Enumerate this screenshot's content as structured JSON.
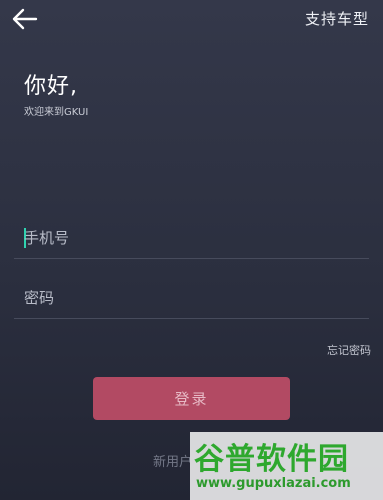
{
  "header": {
    "back_icon": "arrow-left-icon",
    "support_label": "支持车型"
  },
  "welcome": {
    "greeting": "你好,",
    "subtitle": "欢迎来到GKUI"
  },
  "form": {
    "phone_placeholder": "手机号",
    "phone_value": "",
    "password_placeholder": "密码",
    "password_value": "",
    "forgot_label": "忘记密码",
    "login_label": "登录",
    "new_user_label": "新用户"
  },
  "watermark": {
    "logo_text": "谷普软件园",
    "url": "www.gupuxlazai.com"
  },
  "colors": {
    "background": "#2f3344",
    "accent_caret": "#2fd3b0",
    "login_button": "#b24a63",
    "watermark_green": "#2ea82e"
  }
}
